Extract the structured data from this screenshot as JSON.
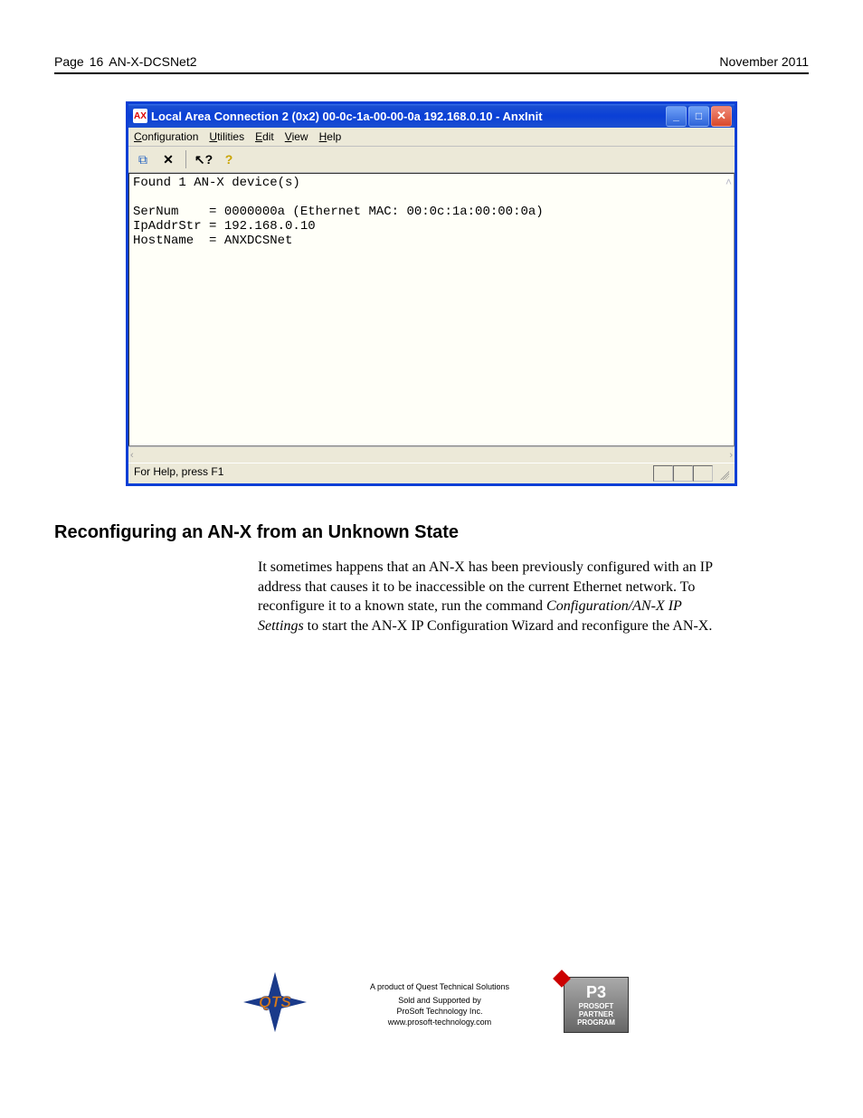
{
  "header": {
    "page_label": "Page",
    "page_number": "16",
    "doc_title": "AN-X-DCSNet2",
    "date": "November 2011"
  },
  "screenshot": {
    "title": "Local Area Connection 2 (0x2) 00-0c-1a-00-00-0a  192.168.0.10 - AnxInit",
    "menus": [
      "Configuration",
      "Utilities",
      "Edit",
      "View",
      "Help"
    ],
    "content": "Found 1 AN-X device(s)\n\nSerNum    = 0000000a (Ethernet MAC: 00:0c:1a:00:00:0a)\nIpAddrStr = 192.168.0.10\nHostName  = ANXDCSNet",
    "statusbar": "For Help, press F1"
  },
  "section": {
    "heading": "Reconfiguring an AN-X from an Unknown State",
    "para_before_italic": "It sometimes happens that an AN-X has been previously configured with an IP address that causes it to be inaccessible on the current Ethernet network.  To reconfigure it to a known state, run the command ",
    "italic": "Configuration/AN-X IP Settings",
    "para_after_italic": " to start the AN-X IP Configuration Wizard and reconfigure the AN-X."
  },
  "footer": {
    "line1": "A product of Quest Technical Solutions",
    "line2": "Sold and Supported by",
    "line3": "ProSoft Technology Inc.",
    "line4": "www.prosoft-technology.com",
    "p3_lines": [
      "PROSOFT",
      "PARTNER",
      "PROGRAM"
    ]
  }
}
